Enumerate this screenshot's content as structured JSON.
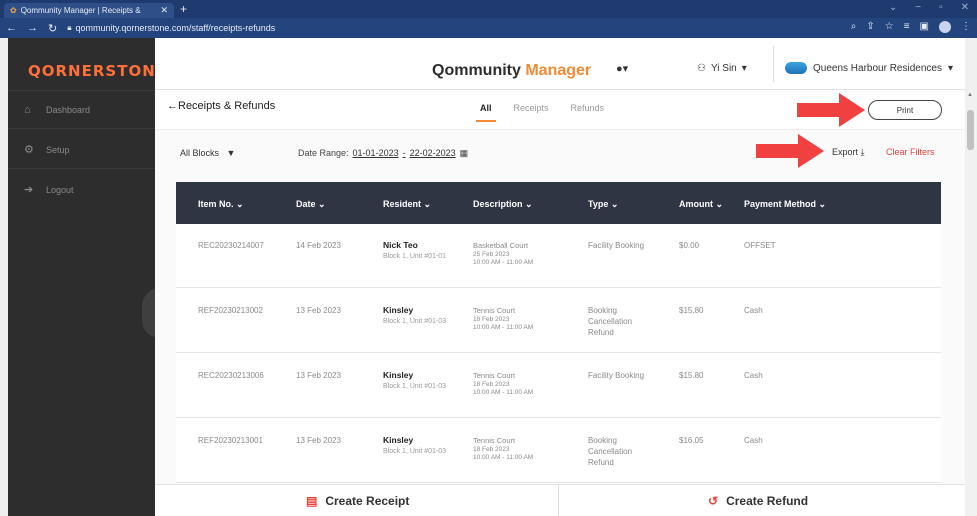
{
  "browser": {
    "tab_title": "Qommunity Manager | Receipts &",
    "url": "qommunity.qornerstone.com/staff/receipts-refunds"
  },
  "sidebar": {
    "brand": "QORNERSTONE",
    "items": [
      {
        "label": "Dashboard",
        "icon": "home-icon"
      },
      {
        "label": "Setup",
        "icon": "gear-icon"
      },
      {
        "label": "Logout",
        "icon": "logout-icon"
      }
    ]
  },
  "header": {
    "title_main": "Qommunity ",
    "title_accent": "Manager",
    "user": "Yi Sin",
    "estate": "Queens Harbour Residences",
    "accent_color": "#f18a33"
  },
  "page": {
    "back_title": "←Receipts & Refunds",
    "tabs": [
      "All",
      "Receipts",
      "Refunds"
    ],
    "print_label": "Print"
  },
  "filters": {
    "blocks": "All Blocks",
    "date_label": "Date Range:",
    "date_from": "01-01-2023",
    "date_to": "22-02-2023",
    "export_label": "Export",
    "clear_label": "Clear Filters"
  },
  "table": {
    "headers": [
      "Item No. ⌄",
      "Date ⌄",
      "Resident ⌄",
      "Description ⌄",
      "Type ⌄",
      "Amount ⌄",
      "Payment Method ⌄"
    ],
    "rows": [
      {
        "item": "REC20230214007",
        "date": "14 Feb 2023",
        "name": "Nick Teo",
        "unit": "Block 1, Unit #01-01",
        "desc": "Basketball Court",
        "desc_date": "25 Feb 2023",
        "desc_time": "10:00 AM - 11:00 AM",
        "type": "Facility Booking",
        "amount": "$0.00",
        "method": "OFFSET"
      },
      {
        "item": "REF20230213002",
        "date": "13 Feb 2023",
        "name": "Kinsley",
        "unit": "Block 1, Unit #01-03",
        "desc": "Tennis Court",
        "desc_date": "18 Feb 2023",
        "desc_time": "10:00 AM - 11:00 AM",
        "type": "Booking Cancellation Refund",
        "amount": "$15.80",
        "method": "Cash"
      },
      {
        "item": "REC20230213006",
        "date": "13 Feb 2023",
        "name": "Kinsley",
        "unit": "Block 1, Unit #01-03",
        "desc": "Tennis Court",
        "desc_date": "18 Feb 2023",
        "desc_time": "10:00 AM - 11:00 AM",
        "type": "Facility Booking",
        "amount": "$15.80",
        "method": "Cash"
      },
      {
        "item": "REF20230213001",
        "date": "13 Feb 2023",
        "name": "Kinsley",
        "unit": "Block 1, Unit #01-03",
        "desc": "Tennis Court",
        "desc_date": "18 Feb 2023",
        "desc_time": "10:00 AM - 11:00 AM",
        "type": "Booking Cancellation Refund",
        "amount": "$16.05",
        "method": "Cash"
      }
    ]
  },
  "actions": {
    "create_receipt": "Create Receipt",
    "create_refund": "Create Refund"
  }
}
